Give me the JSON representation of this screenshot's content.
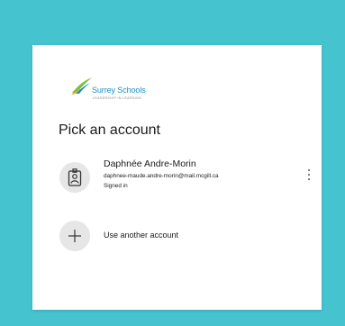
{
  "logo": {
    "name": "Surrey Schools",
    "tagline": "LEADERSHIP IN LEARNING"
  },
  "title": "Pick an account",
  "account": {
    "name": "Daphnée Andre-Morin",
    "email": "daphnee-maude.andre-morin@mail.mcgill.ca",
    "status": "Signed in",
    "icon": "badge-icon"
  },
  "add_account": {
    "label": "Use another account",
    "icon": "plus-icon"
  },
  "colors": {
    "background": "#45c3cf",
    "card": "#ffffff",
    "brand_blue": "#1a8fc9",
    "brand_green": "#7cbf3a"
  }
}
